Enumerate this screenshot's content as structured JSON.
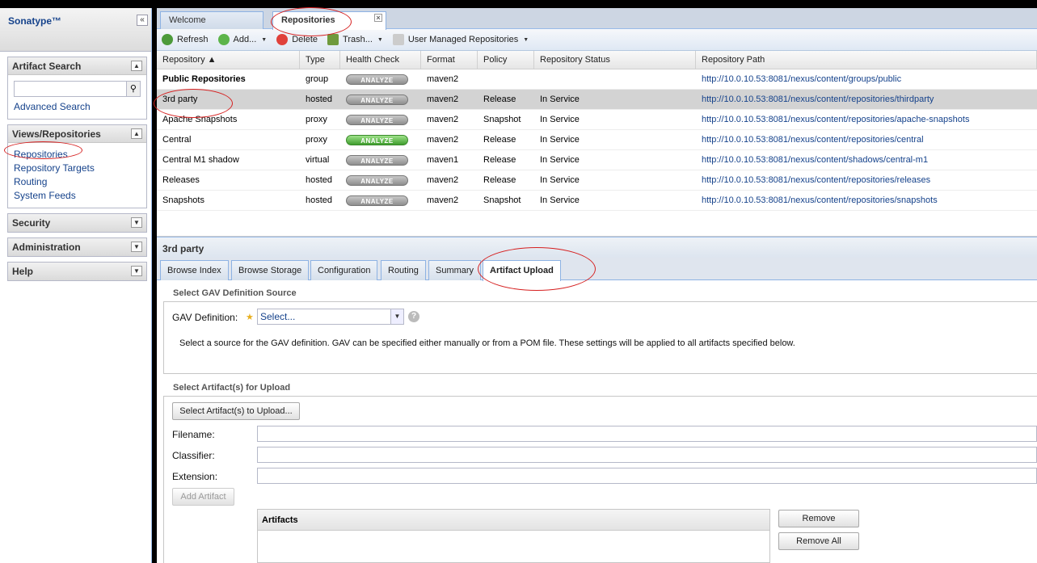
{
  "sidebar": {
    "brand": "Sonatype™",
    "collapse_glyph": "«",
    "artifact_search": {
      "title": "Artifact Search",
      "advanced_link": "Advanced Search"
    },
    "views": {
      "title": "Views/Repositories",
      "items": [
        "Repositories",
        "Repository Targets",
        "Routing",
        "System Feeds"
      ]
    },
    "security": {
      "title": "Security"
    },
    "administration": {
      "title": "Administration"
    },
    "help": {
      "title": "Help"
    }
  },
  "tabs": {
    "welcome": "Welcome",
    "repositories": "Repositories"
  },
  "toolbar": {
    "refresh": "Refresh",
    "add": "Add...",
    "delete": "Delete",
    "trash": "Trash...",
    "user_managed": "User Managed Repositories"
  },
  "grid": {
    "headers": [
      "Repository ▲",
      "Type",
      "Health Check",
      "Format",
      "Policy",
      "Repository Status",
      "Repository Path"
    ],
    "analyze_label": "ANALYZE",
    "rows": [
      {
        "name": "Public Repositories",
        "type": "group",
        "format": "maven2",
        "policy": "",
        "status": "",
        "path": "http://10.0.10.53:8081/nexus/content/groups/public"
      },
      {
        "name": "3rd party",
        "type": "hosted",
        "format": "maven2",
        "policy": "Release",
        "status": "In Service",
        "path": "http://10.0.10.53:8081/nexus/content/repositories/thirdparty"
      },
      {
        "name": "Apache Snapshots",
        "type": "proxy",
        "format": "maven2",
        "policy": "Snapshot",
        "status": "In Service",
        "path": "http://10.0.10.53:8081/nexus/content/repositories/apache-snapshots"
      },
      {
        "name": "Central",
        "type": "proxy",
        "format": "maven2",
        "policy": "Release",
        "status": "In Service",
        "path": "http://10.0.10.53:8081/nexus/content/repositories/central"
      },
      {
        "name": "Central M1 shadow",
        "type": "virtual",
        "format": "maven1",
        "policy": "Release",
        "status": "In Service",
        "path": "http://10.0.10.53:8081/nexus/content/shadows/central-m1"
      },
      {
        "name": "Releases",
        "type": "hosted",
        "format": "maven2",
        "policy": "Release",
        "status": "In Service",
        "path": "http://10.0.10.53:8081/nexus/content/repositories/releases"
      },
      {
        "name": "Snapshots",
        "type": "hosted",
        "format": "maven2",
        "policy": "Snapshot",
        "status": "In Service",
        "path": "http://10.0.10.53:8081/nexus/content/repositories/snapshots"
      }
    ]
  },
  "detail": {
    "title": "3rd party",
    "tabs": [
      "Browse Index",
      "Browse Storage",
      "Configuration",
      "Routing",
      "Summary",
      "Artifact Upload"
    ],
    "gav": {
      "legend": "Select GAV Definition Source",
      "label": "GAV Definition:",
      "selected": "Select...",
      "help": "Select a source for the GAV definition. GAV can be specified either manually or from a POM file. These settings will be applied to all artifacts specified below."
    },
    "upload": {
      "legend": "Select Artifact(s) for Upload",
      "select_button": "Select Artifact(s) to Upload...",
      "filename_label": "Filename:",
      "classifier_label": "Classifier:",
      "extension_label": "Extension:",
      "add_button": "Add Artifact",
      "artifacts_header": "Artifacts",
      "remove_button": "Remove",
      "remove_all_button": "Remove All"
    }
  },
  "colors": {
    "annotation": "#d62020",
    "link": "#15428b",
    "analyze_green": "#3f9d2e"
  }
}
